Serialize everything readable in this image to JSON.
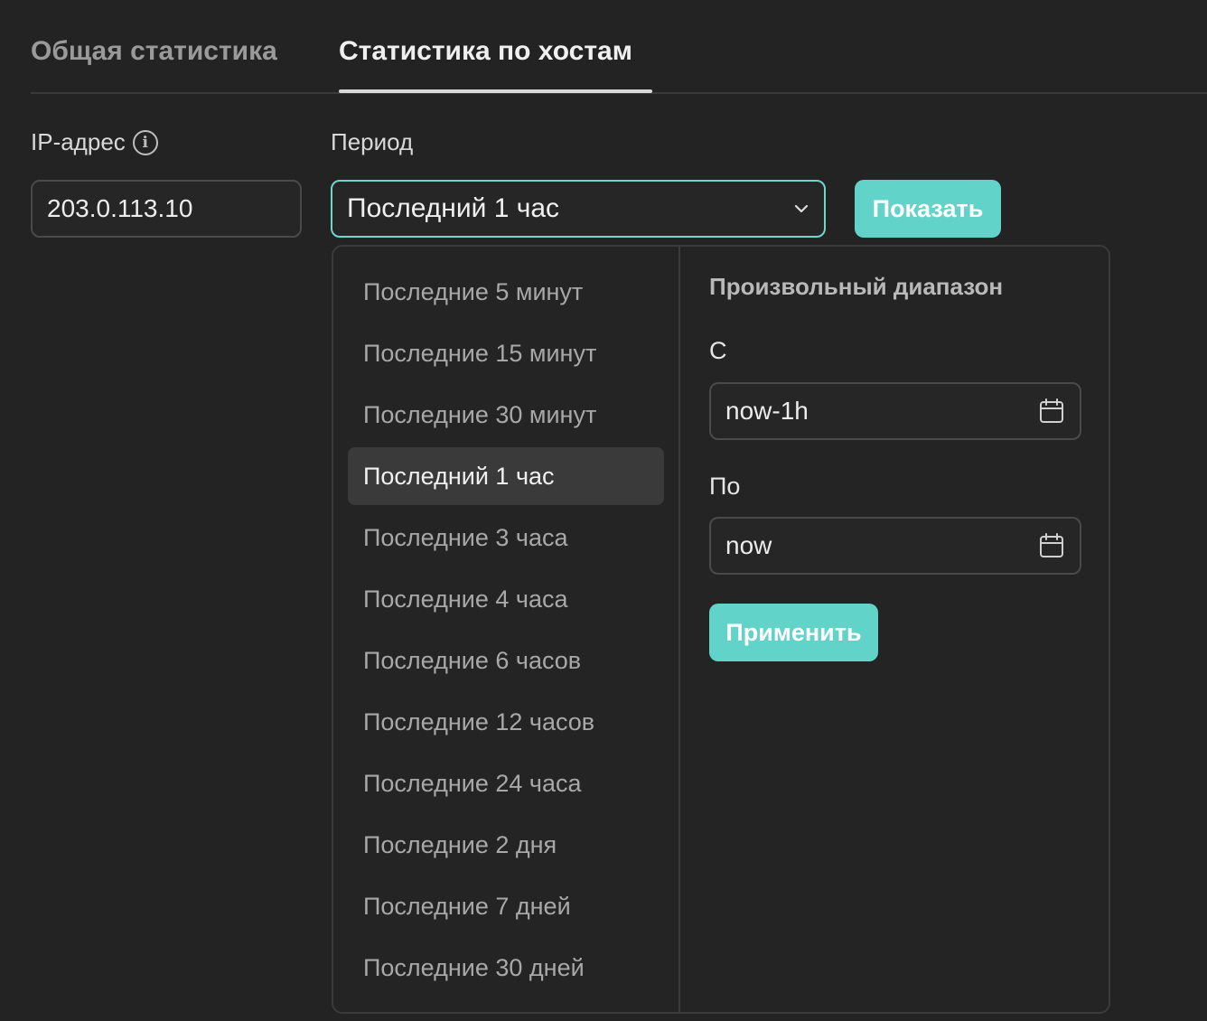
{
  "tabs": [
    {
      "label": "Общая статистика",
      "active": false
    },
    {
      "label": "Статистика по хостам",
      "active": true
    }
  ],
  "form": {
    "ip_label": "IP-адрес",
    "ip_value": "203.0.113.10",
    "period_label": "Период",
    "period_value": "Последний 1 час",
    "show_button": "Показать"
  },
  "dropdown": {
    "options": [
      "Последние 5 минут",
      "Последние 15 минут",
      "Последние 30 минут",
      "Последний 1 час",
      "Последние 3 часа",
      "Последние 4 часа",
      "Последние 6 часов",
      "Последние 12 часов",
      "Последние 24 часа",
      "Последние 2 дня",
      "Последние 7 дней",
      "Последние 30 дней"
    ],
    "selected_index": 3,
    "custom": {
      "title": "Произвольный диапазон",
      "from_label": "С",
      "from_value": "now-1h",
      "to_label": "По",
      "to_value": "now",
      "apply_button": "Применить"
    }
  },
  "colors": {
    "accent": "#62d3c8",
    "background": "#232323",
    "focus_border": "#6fd6cb"
  },
  "icons": {
    "info": "info-icon",
    "chevron": "chevron-down-icon",
    "calendar": "calendar-icon"
  }
}
